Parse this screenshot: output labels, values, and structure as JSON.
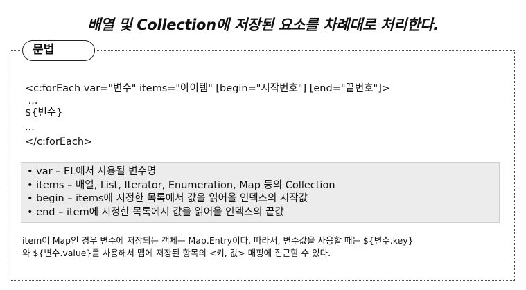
{
  "title": "배열 및 Collection에 저장된 요소를 차례대로 처리한다.",
  "section_label": "문법",
  "syntax_lines": [
    "<c:forEach var=\"변수\" items=\"아이템\" [begin=\"시작번호\"] [end=\"끝번호\"]>",
    " ...",
    "${변수}",
    "...",
    "</c:forEach>"
  ],
  "attributes": [
    "• var – EL에서 사용될 변수명",
    "• items – 배열, List, Iterator, Enumeration, Map 등의 Collection",
    "• begin – items에 지정한 목록에서 값을 읽어올 인덱스의 시작값",
    "• end – item에 지정한 목록에서 값을 읽어올 인덱스의 끝값"
  ],
  "note_lines": [
    "item이 Map인 경우 변수에 저장되는 객체는 Map.Entry이다. 따라서, 변수값을 사용할 때는 ${변수.key}",
    "와 ${변수.value}를 사용해서 맵에 저장된 항목의 <키, 값> 매핑에 접근할 수 있다."
  ]
}
